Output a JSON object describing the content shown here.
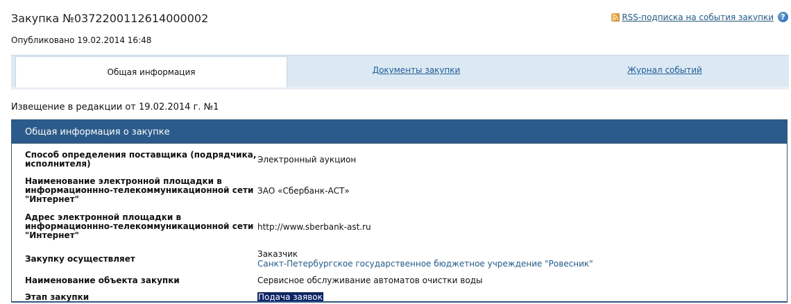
{
  "header": {
    "title": "Закупка №0372200112614000002",
    "published": "Опубликовано 19.02.2014 16:48",
    "rss_label": "RSS-подписка на события закупки",
    "rss_icon": "rss-icon",
    "help_icon": "help-icon",
    "help_glyph": "?"
  },
  "tabs": [
    {
      "label": "Общая информация",
      "active": true
    },
    {
      "label": "Документы закупки",
      "active": false
    },
    {
      "label": "Журнал событий",
      "active": false
    }
  ],
  "notice": "Извещение в редакции от 19.02.2014 г. №1",
  "panel": {
    "title": "Общая информация о закупке",
    "rows": [
      {
        "label": "Способ определения поставщика (подрядчика, исполнителя)",
        "value": "Электронный аукцион"
      },
      {
        "label": "Наименование электронной площадки в информационнно-телекоммуникационной сети \"Интернет\"",
        "value": "ЗАО «Сбербанк-АСТ»"
      },
      {
        "label": "Адрес электронной площадки в информационнно-телекоммуникационной сети \"Интернет\"",
        "value": "http://www.sberbank-ast.ru"
      },
      {
        "label": "Закупку осуществляет",
        "value": "Заказчик",
        "value_link": "Санкт-Петербургское государственное бюджетное учреждение \"Ровесник\""
      },
      {
        "label": "Наименование объекта закупки",
        "value": "Сервисное обслуживание автоматов очистки воды"
      },
      {
        "label": "Этап закупки",
        "value": "Подача заявок"
      }
    ]
  },
  "colors": {
    "panel_header": "#2a5b8c",
    "link": "#1a5ea5",
    "tab_bar": "#dce8f2",
    "selection": "#0b246a"
  }
}
